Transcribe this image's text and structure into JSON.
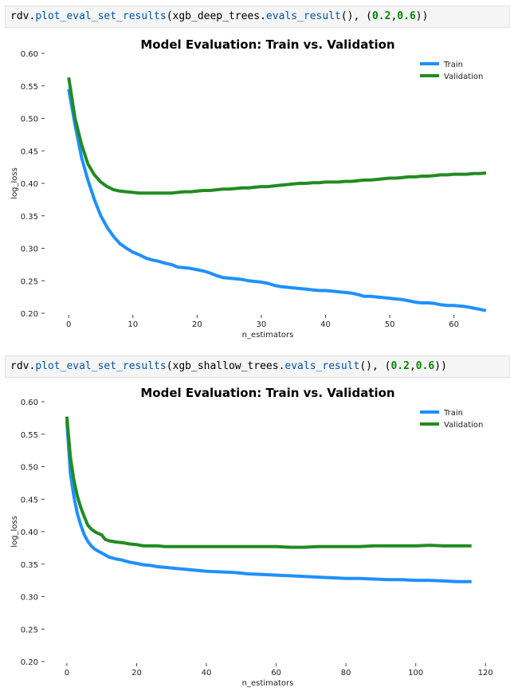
{
  "cells": [
    {
      "code_tokens": [
        {
          "t": "rdv.",
          "c": "plain"
        },
        {
          "t": "plot_eval_set_results",
          "c": "fn"
        },
        {
          "t": "(xgb_deep_trees.",
          "c": "plain"
        },
        {
          "t": "evals_result",
          "c": "fn"
        },
        {
          "t": "(), (",
          "c": "plain"
        },
        {
          "t": "0.2",
          "c": "num"
        },
        {
          "t": ",",
          "c": "plain"
        },
        {
          "t": "0.6",
          "c": "num"
        },
        {
          "t": "))",
          "c": "plain"
        }
      ]
    },
    {
      "code_tokens": [
        {
          "t": "rdv.",
          "c": "plain"
        },
        {
          "t": "plot_eval_set_results",
          "c": "fn"
        },
        {
          "t": "(xgb_shallow_trees.",
          "c": "plain"
        },
        {
          "t": "evals_result",
          "c": "fn"
        },
        {
          "t": "(), (",
          "c": "plain"
        },
        {
          "t": "0.2",
          "c": "num"
        },
        {
          "t": ",",
          "c": "plain"
        },
        {
          "t": "0.6",
          "c": "num"
        },
        {
          "t": "))",
          "c": "plain"
        }
      ]
    }
  ],
  "chart_data": [
    {
      "type": "line",
      "title": "Model Evaluation: Train vs. Validation",
      "xlabel": "n_estimators",
      "ylabel": "log_loss",
      "xlim": [
        -3,
        66
      ],
      "ylim": [
        0.2,
        0.6
      ],
      "xticks": [
        0,
        10,
        20,
        30,
        40,
        50,
        60
      ],
      "yticks": [
        "0.20",
        "0.25",
        "0.30",
        "0.35",
        "0.40",
        "0.45",
        "0.50",
        "0.55",
        "0.60"
      ],
      "grid": false,
      "legend": "top-right",
      "series": [
        {
          "name": "Train",
          "color": "#1e90ff",
          "x": [
            0,
            1,
            2,
            3,
            4,
            5,
            6,
            7,
            8,
            9,
            10,
            11,
            12,
            13,
            14,
            15,
            16,
            17,
            18,
            19,
            20,
            21,
            22,
            23,
            24,
            25,
            26,
            27,
            28,
            29,
            30,
            31,
            32,
            33,
            34,
            35,
            36,
            37,
            38,
            39,
            40,
            41,
            42,
            43,
            44,
            45,
            46,
            47,
            48,
            49,
            50,
            51,
            52,
            53,
            54,
            55,
            56,
            57,
            58,
            59,
            60,
            61,
            62,
            63,
            64,
            65
          ],
          "y": [
            0.545,
            0.49,
            0.44,
            0.405,
            0.375,
            0.35,
            0.332,
            0.318,
            0.307,
            0.3,
            0.294,
            0.29,
            0.285,
            0.282,
            0.28,
            0.277,
            0.275,
            0.271,
            0.27,
            0.269,
            0.267,
            0.265,
            0.262,
            0.258,
            0.255,
            0.254,
            0.253,
            0.252,
            0.25,
            0.249,
            0.248,
            0.246,
            0.243,
            0.241,
            0.24,
            0.239,
            0.238,
            0.237,
            0.236,
            0.235,
            0.235,
            0.234,
            0.233,
            0.232,
            0.231,
            0.229,
            0.226,
            0.226,
            0.225,
            0.224,
            0.223,
            0.222,
            0.221,
            0.219,
            0.217,
            0.216,
            0.216,
            0.215,
            0.213,
            0.212,
            0.212,
            0.211,
            0.21,
            0.208,
            0.206,
            0.204
          ]
        },
        {
          "name": "Validation",
          "color": "#228b22",
          "x": [
            0,
            1,
            2,
            3,
            4,
            5,
            6,
            7,
            8,
            9,
            10,
            11,
            12,
            13,
            14,
            15,
            16,
            17,
            18,
            19,
            20,
            21,
            22,
            23,
            24,
            25,
            26,
            27,
            28,
            29,
            30,
            31,
            32,
            33,
            34,
            35,
            36,
            37,
            38,
            39,
            40,
            41,
            42,
            43,
            44,
            45,
            46,
            47,
            48,
            49,
            50,
            51,
            52,
            53,
            54,
            55,
            56,
            57,
            58,
            59,
            60,
            61,
            62,
            63,
            64,
            65
          ],
          "y": [
            0.563,
            0.5,
            0.46,
            0.43,
            0.413,
            0.402,
            0.395,
            0.39,
            0.388,
            0.387,
            0.386,
            0.385,
            0.385,
            0.385,
            0.385,
            0.385,
            0.385,
            0.386,
            0.387,
            0.387,
            0.388,
            0.389,
            0.389,
            0.39,
            0.391,
            0.391,
            0.392,
            0.393,
            0.393,
            0.394,
            0.395,
            0.395,
            0.396,
            0.397,
            0.398,
            0.399,
            0.4,
            0.4,
            0.401,
            0.401,
            0.402,
            0.402,
            0.402,
            0.403,
            0.403,
            0.404,
            0.405,
            0.405,
            0.406,
            0.407,
            0.408,
            0.408,
            0.409,
            0.41,
            0.41,
            0.411,
            0.411,
            0.412,
            0.413,
            0.413,
            0.414,
            0.414,
            0.414,
            0.415,
            0.415,
            0.416
          ]
        }
      ]
    },
    {
      "type": "line",
      "title": "Model Evaluation: Train vs. Validation",
      "xlabel": "n_estimators",
      "ylabel": "log_loss",
      "xlim": [
        -5,
        122
      ],
      "ylim": [
        0.2,
        0.6
      ],
      "xticks": [
        0,
        20,
        40,
        60,
        80,
        100,
        120
      ],
      "yticks": [
        "0.20",
        "0.25",
        "0.30",
        "0.35",
        "0.40",
        "0.45",
        "0.50",
        "0.55",
        "0.60"
      ],
      "grid": false,
      "legend": "top-right",
      "series": [
        {
          "name": "Train",
          "color": "#1e90ff",
          "x": [
            0,
            1,
            2,
            3,
            4,
            5,
            6,
            7,
            8,
            9,
            10,
            11,
            12,
            14,
            16,
            18,
            20,
            22,
            24,
            26,
            28,
            30,
            32,
            34,
            36,
            38,
            40,
            44,
            48,
            52,
            56,
            60,
            64,
            68,
            72,
            76,
            80,
            84,
            88,
            92,
            96,
            100,
            104,
            108,
            112,
            116
          ],
          "y": [
            0.57,
            0.49,
            0.455,
            0.428,
            0.41,
            0.395,
            0.385,
            0.378,
            0.373,
            0.37,
            0.367,
            0.364,
            0.361,
            0.358,
            0.356,
            0.353,
            0.351,
            0.349,
            0.348,
            0.346,
            0.345,
            0.344,
            0.343,
            0.342,
            0.341,
            0.34,
            0.339,
            0.338,
            0.337,
            0.335,
            0.334,
            0.333,
            0.332,
            0.331,
            0.33,
            0.329,
            0.328,
            0.328,
            0.327,
            0.326,
            0.326,
            0.325,
            0.325,
            0.324,
            0.323,
            0.323
          ]
        },
        {
          "name": "Validation",
          "color": "#228b22",
          "x": [
            0,
            1,
            2,
            3,
            4,
            5,
            6,
            7,
            8,
            9,
            10,
            11,
            12,
            14,
            16,
            18,
            20,
            22,
            24,
            26,
            28,
            30,
            32,
            34,
            36,
            38,
            40,
            44,
            48,
            52,
            56,
            60,
            64,
            68,
            72,
            76,
            80,
            84,
            88,
            92,
            96,
            100,
            104,
            108,
            112,
            116
          ],
          "y": [
            0.577,
            0.515,
            0.48,
            0.455,
            0.437,
            0.423,
            0.41,
            0.404,
            0.4,
            0.397,
            0.395,
            0.388,
            0.386,
            0.384,
            0.383,
            0.381,
            0.38,
            0.378,
            0.378,
            0.378,
            0.377,
            0.377,
            0.377,
            0.377,
            0.377,
            0.377,
            0.377,
            0.377,
            0.377,
            0.377,
            0.377,
            0.377,
            0.376,
            0.376,
            0.377,
            0.377,
            0.377,
            0.377,
            0.378,
            0.378,
            0.378,
            0.378,
            0.379,
            0.378,
            0.378,
            0.378
          ]
        }
      ]
    }
  ]
}
